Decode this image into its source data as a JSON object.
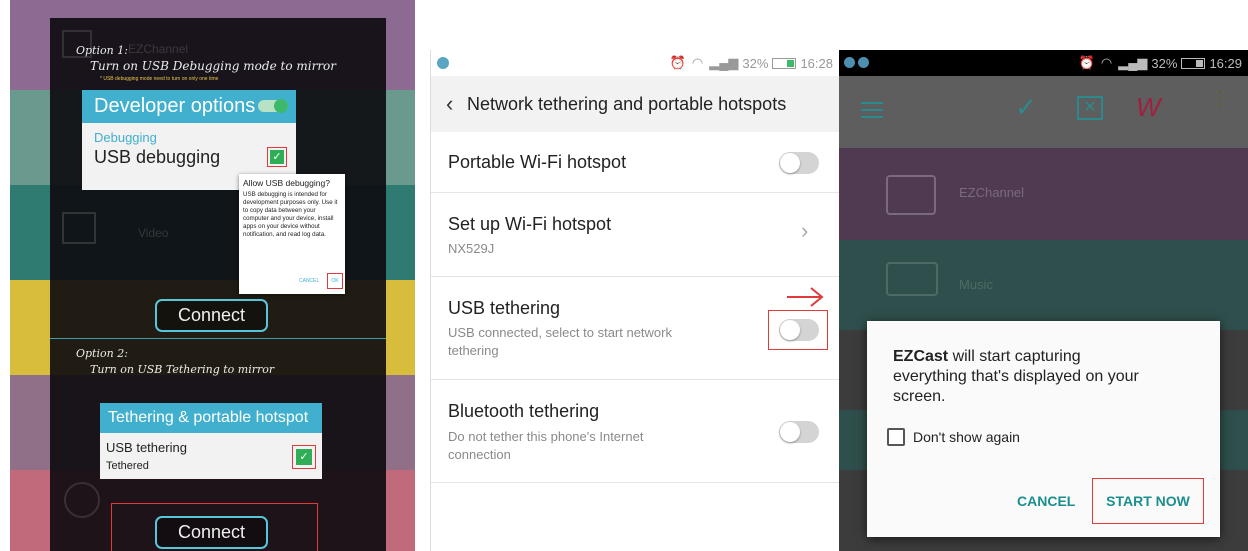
{
  "panel1": {
    "option1_title": "Option 1:",
    "option1_desc": "Turn on USB Debugging mode to mirror",
    "option1_note": "* USB debugging mode need to turn on only one time",
    "dev_title": "Developer options",
    "debugging_label": "Debugging",
    "usb_debugging_label": "USB debugging",
    "allow_title": "Allow USB debugging?",
    "allow_body": "USB debugging is intended for development purposes only. Use it to copy data between your computer and your device, install apps on your device without notification, and read log data.",
    "allow_cancel": "CANCEL",
    "allow_ok": "OK",
    "bg_video": "Video",
    "bg_channel": "EZChannel",
    "connect1": "Connect",
    "option2_title": "Option 2:",
    "option2_desc": "Turn on USB Tethering to mirror",
    "teth_title": "Tethering & portable hotspot",
    "usb_tethering_label": "USB tethering",
    "tethered_label": "Tethered",
    "connect2": "Connect"
  },
  "panel2": {
    "status_text": "32%",
    "time": "16:28",
    "header_title": "Network tethering and portable hotspots",
    "rows": [
      {
        "title": "Portable Wi-Fi hotspot"
      },
      {
        "title": "Set up Wi-Fi hotspot",
        "sub": "NX529J"
      },
      {
        "title": "USB tethering",
        "sub1": "USB connected, select to start network",
        "sub2": "tethering"
      },
      {
        "title": "Bluetooth tethering",
        "sub1": "Do not tether this phone's Internet",
        "sub2": "connection"
      }
    ]
  },
  "panel3": {
    "status_text": "32%",
    "time": "16:29",
    "items": [
      "EZChannel",
      "Music"
    ],
    "dialog_app": "EZCast",
    "dialog_line1": " will start capturing",
    "dialog_line2": "everything that's displayed on your",
    "dialog_line3": "screen.",
    "dont_show": "Don't show again",
    "cancel": "CANCEL",
    "start_now": "START NOW"
  },
  "colors": {
    "accent_blue": "#41b0cf",
    "link_teal": "#1b8f8d",
    "highlight_red": "#e03a3a"
  }
}
